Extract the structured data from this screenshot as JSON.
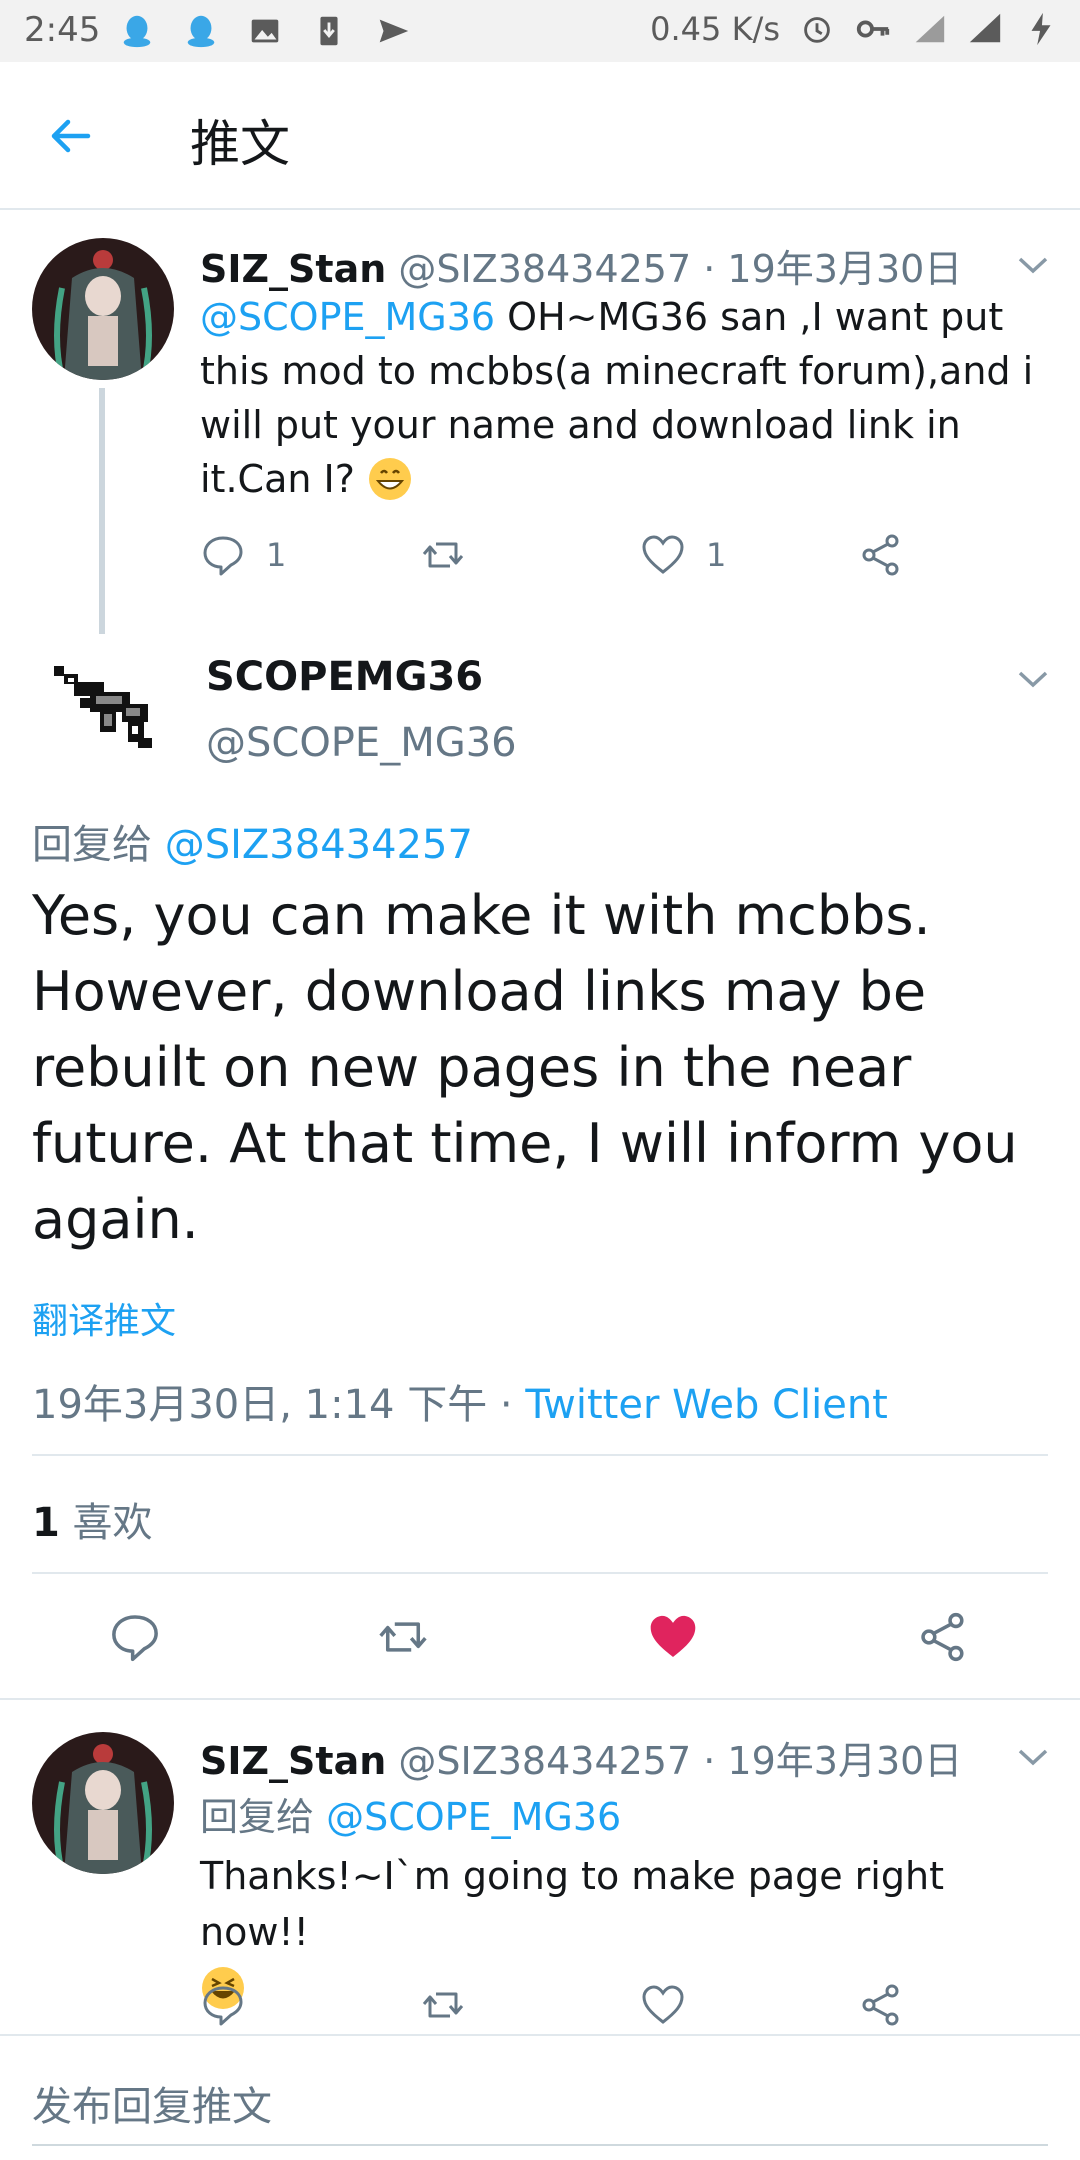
{
  "status_bar": {
    "time": "2:45",
    "network_speed": "0.45 K/s",
    "icons": [
      "qq-icon",
      "qq-icon",
      "image-icon",
      "download-icon",
      "send-icon",
      "alarm-icon",
      "key-icon",
      "signal-4g-icon",
      "signal-icon",
      "charging-icon"
    ]
  },
  "header": {
    "title": "推文"
  },
  "tweet1": {
    "name": "SIZ_Stan",
    "handle": "@SIZ38434257",
    "date": " · 19年3月30日",
    "mention": "@SCOPE_MG36",
    "text": " OH~MG36 san ,I want put this mod to mcbbs(a minecraft forum),and i will put your name and download link in it.Can I?",
    "reply_count": "1",
    "like_count": "1"
  },
  "tweet2": {
    "name": "SCOPEMG36",
    "handle": "@SCOPE_MG36",
    "reply_prefix": "回复给 ",
    "reply_to": "@SIZ38434257",
    "text": "Yes, you can make it with mcbbs. However, download links may be rebuilt on new pages in the near future. At that time, I will inform you again.",
    "translate": "翻译推文",
    "timestamp": "19年3月30日, 1:14 下午 · ",
    "client": "Twitter Web Client",
    "likes_count": "1",
    "likes_label": " 喜欢"
  },
  "tweet3": {
    "name": "SIZ_Stan",
    "handle": "@SIZ38434257",
    "date": " · 19年3月30日",
    "reply_prefix": "回复给 ",
    "reply_to": "@SCOPE_MG36",
    "text": "Thanks!~I`m going to make page right now!!"
  },
  "compose": {
    "placeholder": "发布回复推文"
  },
  "colors": {
    "accent": "#1da1f2",
    "liked": "#e0245e",
    "muted": "#657786"
  }
}
